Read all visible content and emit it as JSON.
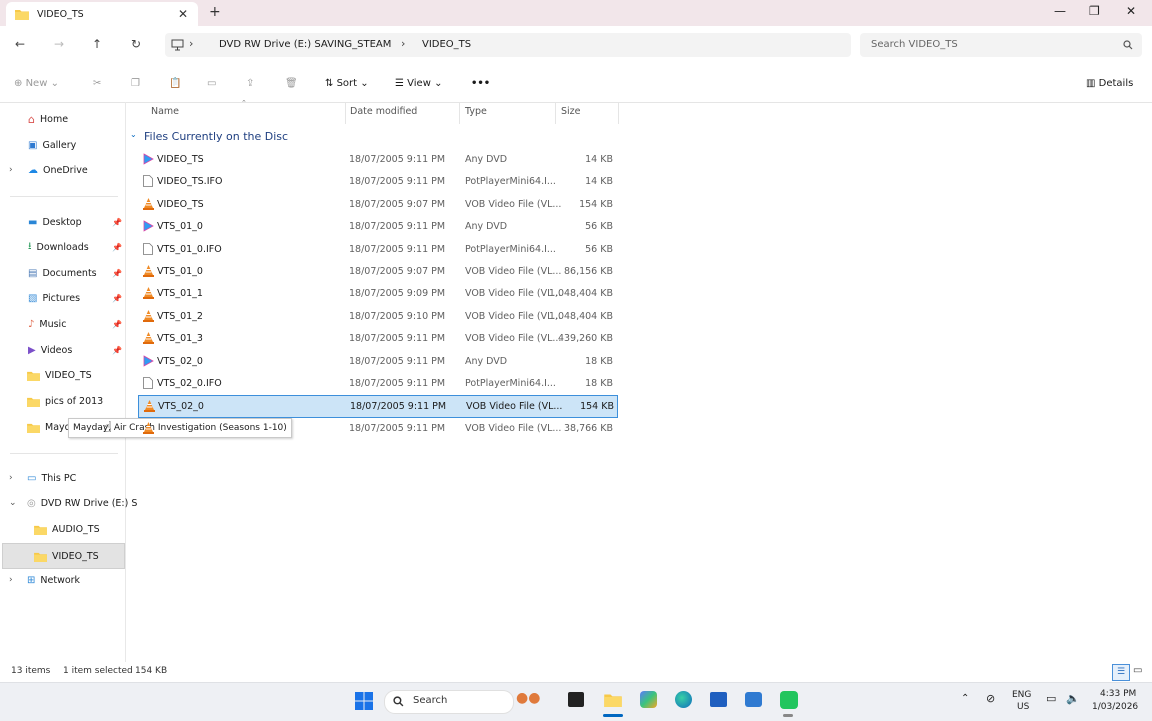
{
  "window": {
    "tab_title": "VIDEO_TS",
    "new_tab": "+",
    "minimize": "—",
    "restore": "❐",
    "close": "✕"
  },
  "address": {
    "crumbs": [
      "DVD RW Drive (E:) SAVING_STEAM",
      "VIDEO_TS"
    ],
    "search_placeholder": "Search VIDEO_TS"
  },
  "toolbar": {
    "new": "New",
    "sort": "Sort",
    "view": "View",
    "more": "•••",
    "details": "Details"
  },
  "sidebar": {
    "home": "Home",
    "gallery": "Gallery",
    "onedrive": "OneDrive",
    "desktop": "Desktop",
    "downloads": "Downloads",
    "documents": "Documents",
    "pictures": "Pictures",
    "music": "Music",
    "videos": "Videos",
    "videots": "VIDEO_TS",
    "pics2013": "pics of 2013",
    "mayday": "Mayday, Air C",
    "thispc": "This PC",
    "dvd": "DVD RW Drive (E:) S",
    "audiots": "AUDIO_TS",
    "videots2": "VIDEO_TS",
    "network": "Network"
  },
  "tooltip": "Mayday, Air Crash Investigation (Seasons 1-10)",
  "columns": {
    "name": "Name",
    "date": "Date modified",
    "type": "Type",
    "size": "Size"
  },
  "group": "Files Currently on the Disc",
  "files": [
    {
      "name": "VIDEO_TS",
      "date": "18/07/2005 9:11 PM",
      "type": "Any DVD",
      "size": "14 KB"
    },
    {
      "name": "VIDEO_TS.IFO",
      "date": "18/07/2005 9:11 PM",
      "type": "PotPlayerMini64.I...",
      "size": "14 KB"
    },
    {
      "name": "VIDEO_TS",
      "date": "18/07/2005 9:07 PM",
      "type": "VOB Video File (VL...",
      "size": "154 KB"
    },
    {
      "name": "VTS_01_0",
      "date": "18/07/2005 9:11 PM",
      "type": "Any DVD",
      "size": "56 KB"
    },
    {
      "name": "VTS_01_0.IFO",
      "date": "18/07/2005 9:11 PM",
      "type": "PotPlayerMini64.I...",
      "size": "56 KB"
    },
    {
      "name": "VTS_01_0",
      "date": "18/07/2005 9:07 PM",
      "type": "VOB Video File (VL...",
      "size": "86,156 KB"
    },
    {
      "name": "VTS_01_1",
      "date": "18/07/2005 9:09 PM",
      "type": "VOB Video File (VL...",
      "size": "1,048,404 KB"
    },
    {
      "name": "VTS_01_2",
      "date": "18/07/2005 9:10 PM",
      "type": "VOB Video File (VL...",
      "size": "1,048,404 KB"
    },
    {
      "name": "VTS_01_3",
      "date": "18/07/2005 9:11 PM",
      "type": "VOB Video File (VL...",
      "size": "439,260 KB"
    },
    {
      "name": "VTS_02_0",
      "date": "18/07/2005 9:11 PM",
      "type": "Any DVD",
      "size": "18 KB"
    },
    {
      "name": "VTS_02_0.IFO",
      "date": "18/07/2005 9:11 PM",
      "type": "PotPlayerMini64.I...",
      "size": "18 KB"
    },
    {
      "name": "VTS_02_0",
      "date": "18/07/2005 9:11 PM",
      "type": "VOB Video File (VL...",
      "size": "154 KB"
    },
    {
      "name": "",
      "date": "18/07/2005 9:11 PM",
      "type": "VOB Video File (VL...",
      "size": "38,766 KB"
    }
  ],
  "status": {
    "items": "13 items",
    "selected": "1 item selected",
    "size": "154 KB"
  },
  "taskbar": {
    "search": "Search",
    "lang1": "ENG",
    "lang2": "US",
    "time": "4:33 PM",
    "date": "1/03/2026"
  },
  "colors": {
    "accent": "#0067c0",
    "selection": "#cce4f7",
    "titlebar": "#f2e6ea",
    "folder": "#f7c948"
  }
}
